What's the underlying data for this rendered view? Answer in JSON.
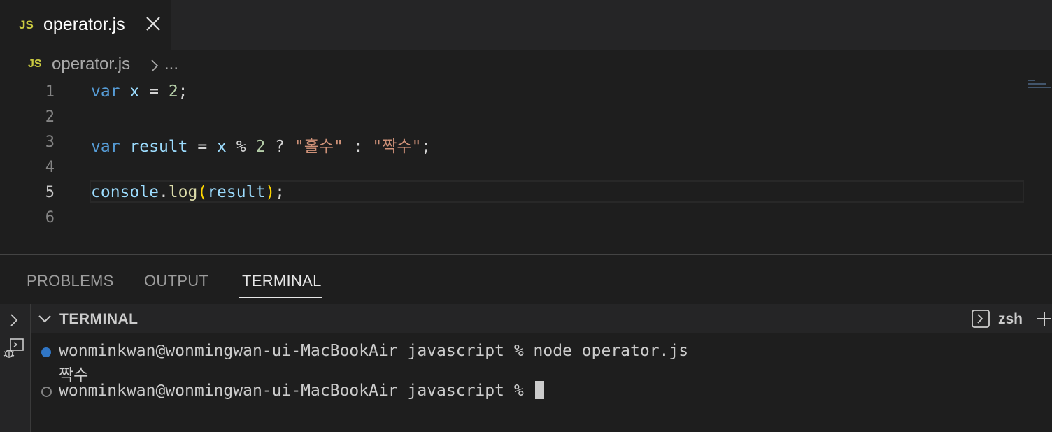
{
  "tab": {
    "icon": "JS",
    "label": "operator.js"
  },
  "breadcrumb": {
    "icon": "JS",
    "file": "operator.js",
    "more": "..."
  },
  "editor": {
    "line_numbers": [
      "1",
      "2",
      "3",
      "4",
      "5",
      "6"
    ],
    "active_line": "5",
    "lines": {
      "l1": {
        "kw": "var",
        "var": "x",
        "op": " = ",
        "num": "2",
        "end": ";"
      },
      "l3": {
        "kw": "var",
        "var": "result",
        "op": " = ",
        "var2": "x",
        "op2": " % ",
        "num": "2",
        "op3": " ? ",
        "str1": "\"홀수\"",
        "op4": " : ",
        "str2": "\"짝수\"",
        "end": ";"
      },
      "l5": {
        "obj": "console",
        "dot": ".",
        "fn": "log",
        "paren_open": "(",
        "arg": "result",
        "paren_close": ")",
        "end": ";"
      }
    }
  },
  "panel": {
    "tabs": [
      "PROBLEMS",
      "OUTPUT",
      "TERMINAL"
    ],
    "active_tab": "TERMINAL",
    "terminal_title": "TERMINAL",
    "shell": "zsh"
  },
  "terminal": {
    "line1": "wonminkwan@wonmingwan-ui-MacBookAir javascript % node operator.js",
    "output": "짝수",
    "line3": "wonminkwan@wonmingwan-ui-MacBookAir javascript % "
  },
  "colors": {
    "keyword": "#569cd6",
    "variable": "#9cdcfe",
    "number": "#b5cea8",
    "string": "#ce9178",
    "function": "#dcdcaa",
    "js_icon": "#cbcb41"
  },
  "icons": [
    "close-icon",
    "chevron-right-icon",
    "chevron-down-icon",
    "terminal-shell-icon",
    "plus-icon",
    "remote-debug-icon"
  ]
}
